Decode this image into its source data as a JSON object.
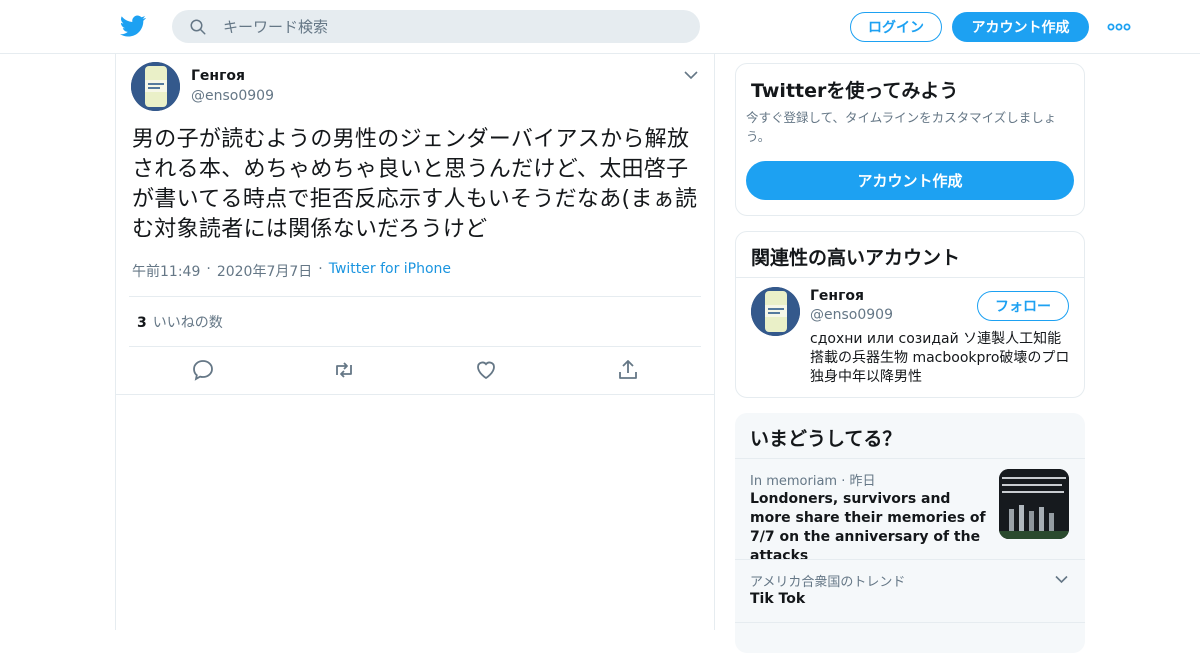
{
  "header": {
    "search_placeholder": "キーワード検索",
    "login_label": "ログイン",
    "signup_label": "アカウント作成"
  },
  "tweet": {
    "display_name": "Генгоя",
    "handle": "@enso0909",
    "text": "男の子が読むようの男性のジェンダーバイアスから解放される本、めちゃめちゃ良いと思うんだけど、太田啓子が書いてる時点で拒否反応示す人もいそうだなあ(まぁ読む対象読者には関係ないだろうけど",
    "time": "午前11:49",
    "date": "2020年7月7日",
    "source": "Twitter for iPhone",
    "likes_count": "3",
    "likes_label": "いいねの数"
  },
  "signup_card": {
    "title": "Twitterを使ってみよう",
    "subtitle": "今すぐ登録して、タイムラインをカスタマイズしましょう。",
    "button_label": "アカウント作成"
  },
  "related_card": {
    "title": "関連性の高いアカウント",
    "name": "Генгоя",
    "handle": "@enso0909",
    "follow_label": "フォロー",
    "bio": "сдохни или созидай ソ連製人工知能 搭載の兵器生物 macbookpro破壊のプロ 独身中年以降男性"
  },
  "trends_card": {
    "title": "いまどうしてる？",
    "items": [
      {
        "category": "In memoriam",
        "time": "昨日",
        "title": "Londoners, survivors and more share their memories of 7/7 on the anniversary of the attacks"
      },
      {
        "category": "アメリカ合衆国のトレンド",
        "title": "Tik Tok"
      }
    ]
  },
  "colors": {
    "accent": "#1da1f2",
    "text_primary": "#14171a",
    "text_secondary": "#657786",
    "border": "#e6ecf0"
  }
}
